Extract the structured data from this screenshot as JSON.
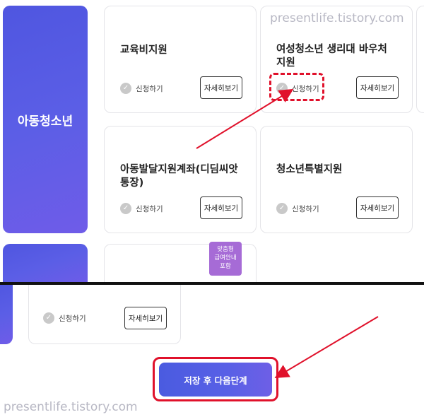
{
  "sections": {
    "youth_label": "아동청소년"
  },
  "cards": {
    "education": {
      "title": "교육비지원",
      "apply": "신청하기",
      "detail": "자세히보기"
    },
    "menstrual": {
      "title_line1": "여성청소년 생리대 바우처",
      "title_line2": "지원",
      "apply": "신청하기",
      "detail": "자세히보기"
    },
    "didim": {
      "title_line1": "아동발달지원계좌(디딤씨앗",
      "title_line2": "통장)",
      "apply": "신청하기",
      "detail": "자세히보기"
    },
    "special": {
      "title": "청소년특별지원",
      "apply": "신청하기",
      "detail": "자세히보기"
    },
    "lower": {
      "apply": "신청하기",
      "detail": "자세히보기"
    }
  },
  "badge": {
    "line1": "맞춤형",
    "line2": "급여안내",
    "line3": "포함"
  },
  "save_button": "저장 후 다음단계",
  "watermark": "presentlife.tistory.com",
  "icons": {
    "check": "check-circle-icon",
    "arrow": "red-arrow-icon"
  },
  "colors": {
    "accent": "#5a5de5",
    "highlight": "#e0112b",
    "badge": "#a66bd6"
  }
}
